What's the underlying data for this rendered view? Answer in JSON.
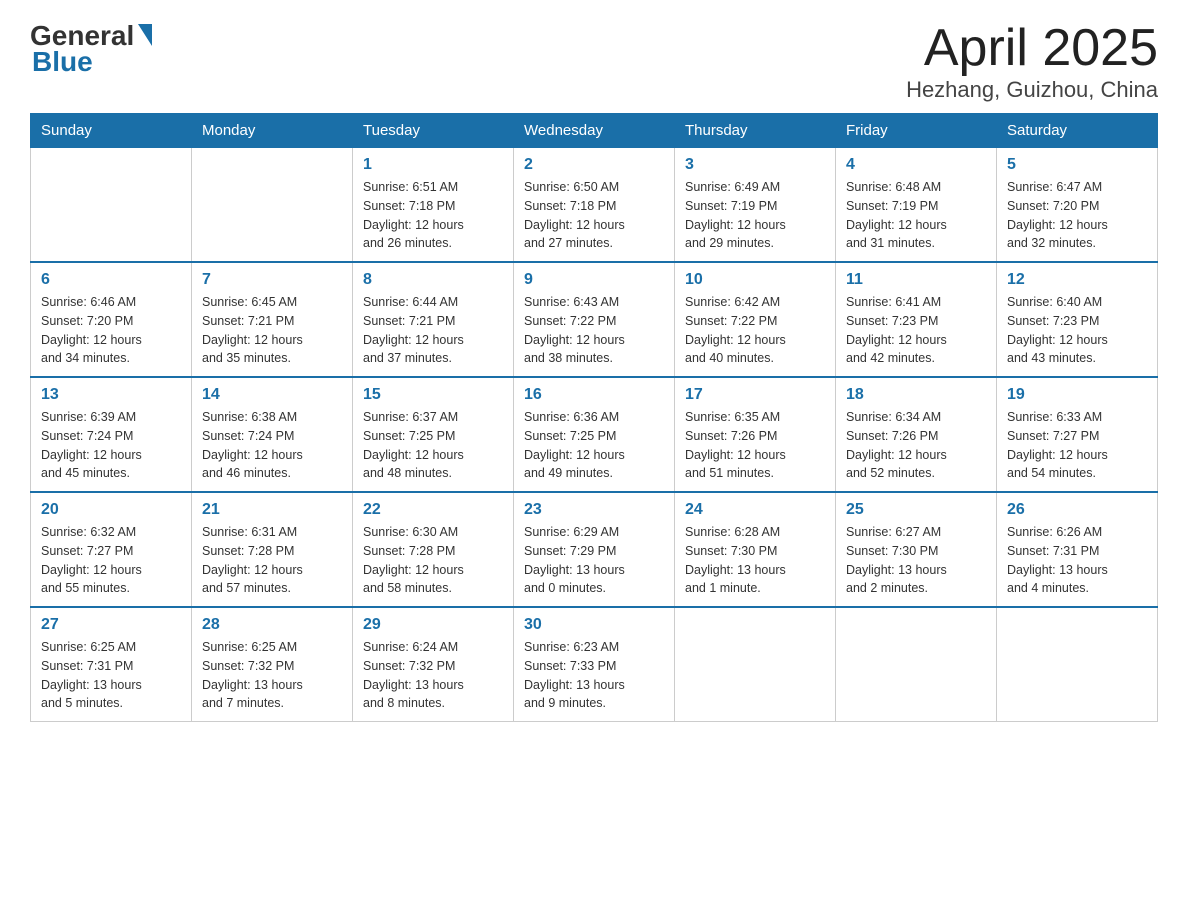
{
  "header": {
    "logo_general": "General",
    "logo_blue": "Blue",
    "title": "April 2025",
    "subtitle": "Hezhang, Guizhou, China"
  },
  "calendar": {
    "weekdays": [
      "Sunday",
      "Monday",
      "Tuesday",
      "Wednesday",
      "Thursday",
      "Friday",
      "Saturday"
    ],
    "weeks": [
      [
        {
          "day": "",
          "info": ""
        },
        {
          "day": "",
          "info": ""
        },
        {
          "day": "1",
          "info": "Sunrise: 6:51 AM\nSunset: 7:18 PM\nDaylight: 12 hours\nand 26 minutes."
        },
        {
          "day": "2",
          "info": "Sunrise: 6:50 AM\nSunset: 7:18 PM\nDaylight: 12 hours\nand 27 minutes."
        },
        {
          "day": "3",
          "info": "Sunrise: 6:49 AM\nSunset: 7:19 PM\nDaylight: 12 hours\nand 29 minutes."
        },
        {
          "day": "4",
          "info": "Sunrise: 6:48 AM\nSunset: 7:19 PM\nDaylight: 12 hours\nand 31 minutes."
        },
        {
          "day": "5",
          "info": "Sunrise: 6:47 AM\nSunset: 7:20 PM\nDaylight: 12 hours\nand 32 minutes."
        }
      ],
      [
        {
          "day": "6",
          "info": "Sunrise: 6:46 AM\nSunset: 7:20 PM\nDaylight: 12 hours\nand 34 minutes."
        },
        {
          "day": "7",
          "info": "Sunrise: 6:45 AM\nSunset: 7:21 PM\nDaylight: 12 hours\nand 35 minutes."
        },
        {
          "day": "8",
          "info": "Sunrise: 6:44 AM\nSunset: 7:21 PM\nDaylight: 12 hours\nand 37 minutes."
        },
        {
          "day": "9",
          "info": "Sunrise: 6:43 AM\nSunset: 7:22 PM\nDaylight: 12 hours\nand 38 minutes."
        },
        {
          "day": "10",
          "info": "Sunrise: 6:42 AM\nSunset: 7:22 PM\nDaylight: 12 hours\nand 40 minutes."
        },
        {
          "day": "11",
          "info": "Sunrise: 6:41 AM\nSunset: 7:23 PM\nDaylight: 12 hours\nand 42 minutes."
        },
        {
          "day": "12",
          "info": "Sunrise: 6:40 AM\nSunset: 7:23 PM\nDaylight: 12 hours\nand 43 minutes."
        }
      ],
      [
        {
          "day": "13",
          "info": "Sunrise: 6:39 AM\nSunset: 7:24 PM\nDaylight: 12 hours\nand 45 minutes."
        },
        {
          "day": "14",
          "info": "Sunrise: 6:38 AM\nSunset: 7:24 PM\nDaylight: 12 hours\nand 46 minutes."
        },
        {
          "day": "15",
          "info": "Sunrise: 6:37 AM\nSunset: 7:25 PM\nDaylight: 12 hours\nand 48 minutes."
        },
        {
          "day": "16",
          "info": "Sunrise: 6:36 AM\nSunset: 7:25 PM\nDaylight: 12 hours\nand 49 minutes."
        },
        {
          "day": "17",
          "info": "Sunrise: 6:35 AM\nSunset: 7:26 PM\nDaylight: 12 hours\nand 51 minutes."
        },
        {
          "day": "18",
          "info": "Sunrise: 6:34 AM\nSunset: 7:26 PM\nDaylight: 12 hours\nand 52 minutes."
        },
        {
          "day": "19",
          "info": "Sunrise: 6:33 AM\nSunset: 7:27 PM\nDaylight: 12 hours\nand 54 minutes."
        }
      ],
      [
        {
          "day": "20",
          "info": "Sunrise: 6:32 AM\nSunset: 7:27 PM\nDaylight: 12 hours\nand 55 minutes."
        },
        {
          "day": "21",
          "info": "Sunrise: 6:31 AM\nSunset: 7:28 PM\nDaylight: 12 hours\nand 57 minutes."
        },
        {
          "day": "22",
          "info": "Sunrise: 6:30 AM\nSunset: 7:28 PM\nDaylight: 12 hours\nand 58 minutes."
        },
        {
          "day": "23",
          "info": "Sunrise: 6:29 AM\nSunset: 7:29 PM\nDaylight: 13 hours\nand 0 minutes."
        },
        {
          "day": "24",
          "info": "Sunrise: 6:28 AM\nSunset: 7:30 PM\nDaylight: 13 hours\nand 1 minute."
        },
        {
          "day": "25",
          "info": "Sunrise: 6:27 AM\nSunset: 7:30 PM\nDaylight: 13 hours\nand 2 minutes."
        },
        {
          "day": "26",
          "info": "Sunrise: 6:26 AM\nSunset: 7:31 PM\nDaylight: 13 hours\nand 4 minutes."
        }
      ],
      [
        {
          "day": "27",
          "info": "Sunrise: 6:25 AM\nSunset: 7:31 PM\nDaylight: 13 hours\nand 5 minutes."
        },
        {
          "day": "28",
          "info": "Sunrise: 6:25 AM\nSunset: 7:32 PM\nDaylight: 13 hours\nand 7 minutes."
        },
        {
          "day": "29",
          "info": "Sunrise: 6:24 AM\nSunset: 7:32 PM\nDaylight: 13 hours\nand 8 minutes."
        },
        {
          "day": "30",
          "info": "Sunrise: 6:23 AM\nSunset: 7:33 PM\nDaylight: 13 hours\nand 9 minutes."
        },
        {
          "day": "",
          "info": ""
        },
        {
          "day": "",
          "info": ""
        },
        {
          "day": "",
          "info": ""
        }
      ]
    ]
  }
}
